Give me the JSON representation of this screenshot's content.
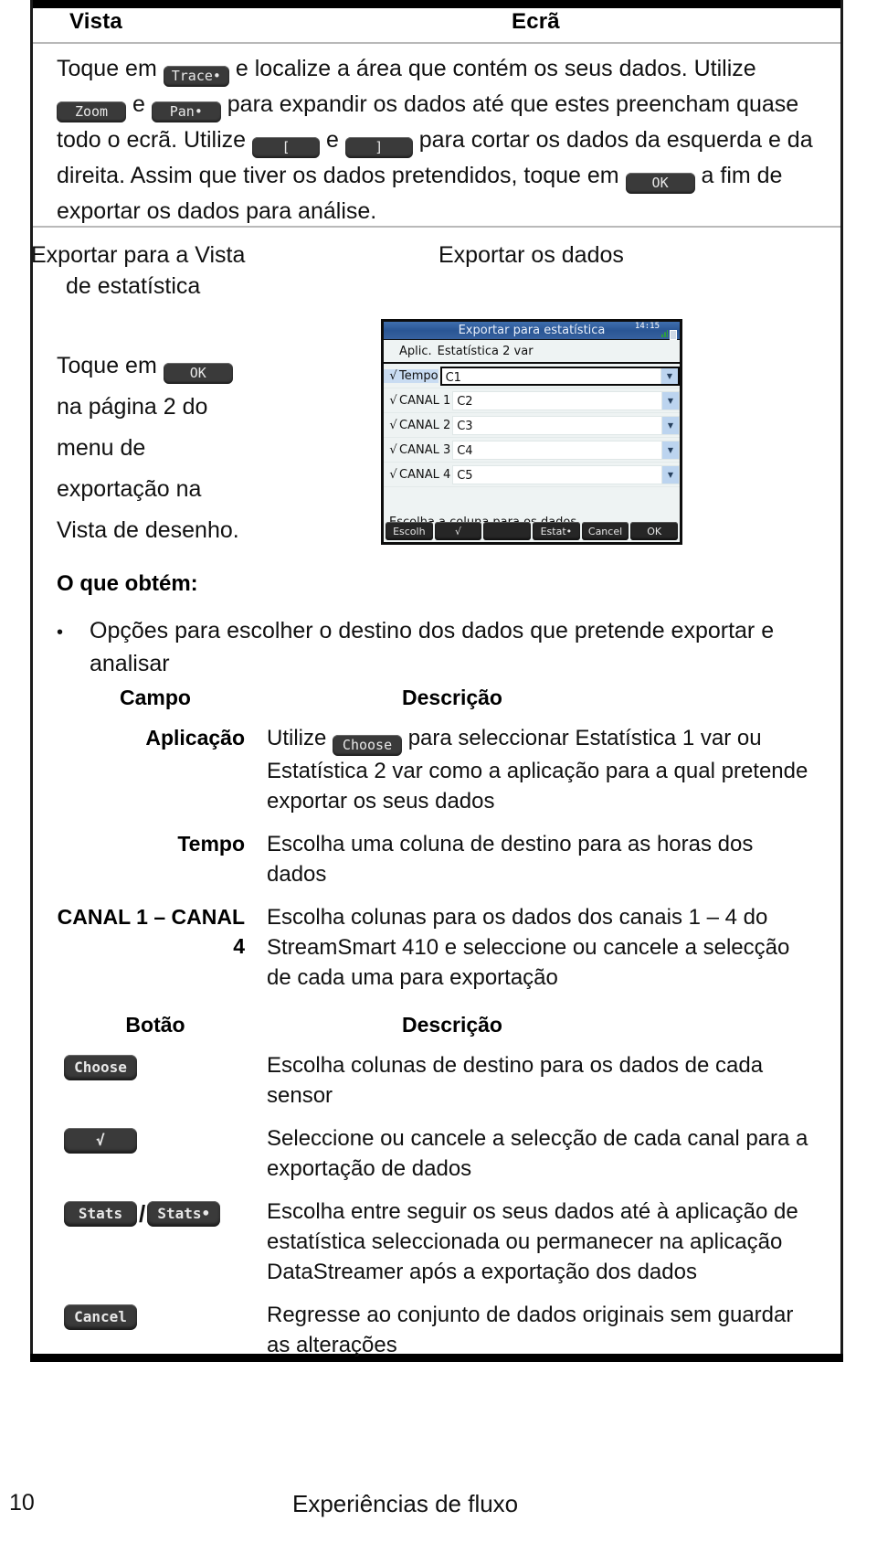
{
  "header": {
    "col_left": "Vista",
    "col_right": "Ecrã"
  },
  "intro": {
    "p1": "Toque em",
    "k_trace": "Trace•",
    "p2": "e localize a área que contém os seus dados. Utilize",
    "k_zoom": "Zoom",
    "p3": "e",
    "k_pan": "Pan•",
    "p4": "para expandir os dados até que estes preencham quase todo o ecrã. Utilize",
    "k_lbracket": "[",
    "p5": "e",
    "k_rbracket": "]",
    "p6": "para cortar os dados da esquerda e da direita. Assim que tiver os dados pretendidos, toque em",
    "k_ok": "OK",
    "p7": "a fim de exportar os dados para análise."
  },
  "captions": {
    "left_line1": "Exportar para a Vista",
    "left_line2": "de estatística",
    "right": "Exportar os dados"
  },
  "left_steps": {
    "l1a": "Toque em",
    "l1_key": "OK",
    "l2": "na página 2 do",
    "l3": "menu de",
    "l4": "exportação na",
    "l5": "Vista de desenho."
  },
  "calculator": {
    "title": "Exportar para estatística",
    "clock": "14:15",
    "aplic_label": "Aplic.",
    "aplic_value": "Estatística 2 var",
    "rows": [
      {
        "check": "√",
        "label": "Tempo",
        "value": "C1",
        "selected": true
      },
      {
        "check": "√",
        "label": "CANAL 1",
        "value": "C2",
        "selected": false
      },
      {
        "check": "√",
        "label": "CANAL 2",
        "value": "C3",
        "selected": false
      },
      {
        "check": "√",
        "label": "CANAL 3",
        "value": "C4",
        "selected": false
      },
      {
        "check": "√",
        "label": "CANAL 4",
        "value": "C5",
        "selected": false
      }
    ],
    "hint": "Escolha a coluna para os dados",
    "toolbar": [
      "Escolh",
      "√",
      "",
      "Estat•",
      "Cancel",
      "OK"
    ]
  },
  "obtem": {
    "heading": "O que obtém:",
    "bullet_dot": "•",
    "bullet_text": "Opções para escolher o destino dos dados que pretende exportar e analisar"
  },
  "table_campo": {
    "head_c1": "Campo",
    "head_c2": "Descrição",
    "rows": [
      {
        "field": "Aplicação",
        "desc_pre": "Utilize",
        "key": "Choose",
        "desc_post": "para seleccionar Estatística 1 var ou Estatística 2 var como a aplicação para a qual pretende exportar os seus dados"
      },
      {
        "field": "Tempo",
        "desc_pre": "",
        "key": "",
        "desc_post": "Escolha uma coluna de destino para as horas dos dados"
      },
      {
        "field": "CANAL 1 – CANAL 4",
        "desc_pre": "",
        "key": "",
        "desc_post": "Escolha colunas para os dados dos canais 1 – 4 do StreamSmart 410 e seleccione ou cancele a selecção de cada uma para exportação"
      }
    ]
  },
  "table_botao": {
    "head_c1": "Botão",
    "head_c2": "Descrição",
    "rows": [
      {
        "keys": [
          "Choose"
        ],
        "desc": "Escolha colunas de destino para os dados de cada sensor"
      },
      {
        "keys": [
          "√"
        ],
        "desc": "Seleccione ou cancele a selecção de cada canal para a exportação de dados"
      },
      {
        "keys": [
          "Stats",
          "Stats•"
        ],
        "separator": "/",
        "desc": "Escolha entre seguir os seus dados até à aplicação de estatística seleccionada ou permanecer na aplicação DataStreamer após a exportação dos dados"
      },
      {
        "keys": [
          "Cancel"
        ],
        "desc": "Regresse ao conjunto de dados originais sem guardar as alterações"
      }
    ]
  },
  "footer": {
    "page_number": "10",
    "title": "Experiências de fluxo"
  }
}
